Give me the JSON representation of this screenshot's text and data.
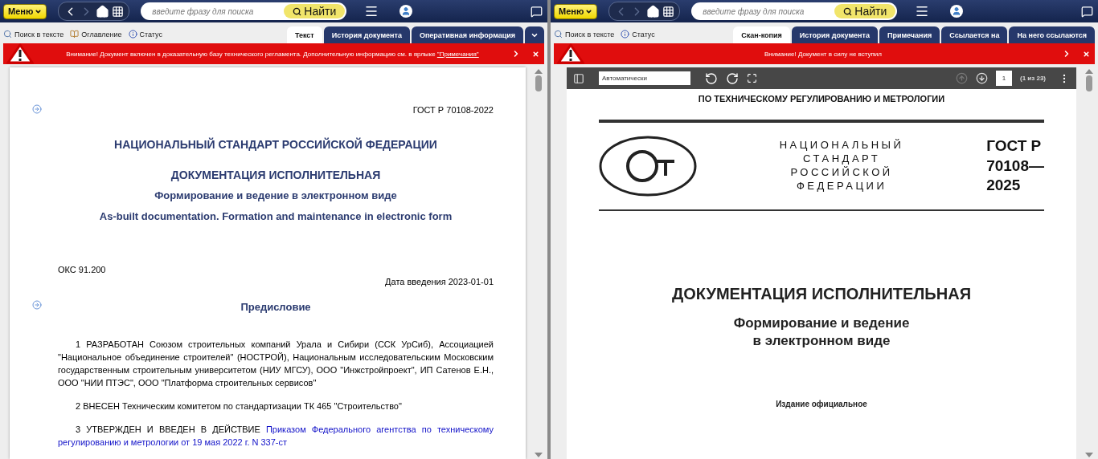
{
  "panels": [
    {
      "topbar": {
        "menu": "Меню",
        "nav": [
          {
            "disabled": false
          },
          {
            "disabled": true
          },
          {
            "disabled": false
          },
          {
            "disabled": false
          }
        ],
        "search": {
          "placeholder": "введите фразу для поиска",
          "button": "Найти"
        }
      },
      "tools": [
        {
          "kind": "search",
          "label": "Поиск в тексте"
        },
        {
          "kind": "contents",
          "label": "Оглавление"
        },
        {
          "kind": "status",
          "label": "Статус"
        }
      ],
      "tabs": [
        {
          "label": "Текст",
          "selected": true
        },
        {
          "label": "История документа",
          "selected": false
        },
        {
          "label": "Оперативная информация",
          "selected": false
        }
      ],
      "tabs_more": true,
      "alert": {
        "text": "Внимание! Документ включен в доказательную базу технического регламента. Дополнительную информацию см. в ярлыке ",
        "link": "\"Примечания\""
      },
      "content": {
        "kind": "text",
        "blocks": [
          {
            "kind": "right",
            "text": "ГОСТ Р 70108-2022",
            "marker": true
          },
          {
            "kind": "title",
            "text": "НАЦИОНАЛЬНЫЙ СТАНДАРТ РОССИЙСКОЙ ФЕДЕРАЦИИ",
            "marker": false
          },
          {
            "kind": "title",
            "text": "ДОКУМЕНТАЦИЯ ИСПОЛНИТЕЛЬНАЯ",
            "marker": false
          },
          {
            "kind": "subtitle",
            "text": "Формирование и ведение в электронном виде",
            "marker": false
          },
          {
            "kind": "subtitle",
            "text": "As-built documentation. Formation and maintenance in electronic form",
            "marker": false
          },
          {
            "kind": "left",
            "text": "ОКС 91.200",
            "marker": false
          },
          {
            "kind": "right",
            "text": "Дата введения 2023-01-01",
            "marker": false
          },
          {
            "kind": "heading",
            "text": "Предисловие",
            "marker": true
          },
          {
            "kind": "para",
            "number": "1",
            "text": " РАЗРАБОТАН Союзом строительных компаний Урала и Сибири (ССК УрСиб), Ассоциацией \"Национальное объединение строителей\" (НОСТРОЙ), Национальным исследовательским Московским государственным строительным университетом (НИУ МГСУ), ООО \"Инжстройпроект\", ИП Сатенов Е.Н., ООО \"НИИ ПТЭС\", ООО \"Платформа строительных сервисов\"",
            "marker": false
          },
          {
            "kind": "para",
            "number": "2",
            "text": " ВНЕСЕН Техническим комитетом по стандартизации ТК 465 \"Строительство\"",
            "marker": false
          },
          {
            "kind": "para",
            "number": "3",
            "text": " УТВЕРЖДЕН И ВВЕДЕН В ДЕЙСТВИЕ ",
            "link": "Приказом Федерального агентства по техническому регулированию и метрологии от 19 мая 2022 г. N 337-ст",
            "marker": false
          }
        ]
      }
    },
    {
      "topbar": {
        "menu": "Меню",
        "nav": [
          {
            "disabled": true
          },
          {
            "disabled": true
          },
          {
            "disabled": false
          },
          {
            "disabled": false
          }
        ],
        "search": {
          "placeholder": "введите фразу для поиска",
          "button": "Найти"
        }
      },
      "tools": [
        {
          "kind": "search",
          "label": "Поиск в тексте"
        },
        {
          "kind": "status",
          "label": "Статус"
        }
      ],
      "tabs": [
        {
          "label": "Скан-копия",
          "selected": true
        },
        {
          "label": "История документа",
          "selected": false
        },
        {
          "label": "Примечания",
          "selected": false
        },
        {
          "label": "Ссылается на",
          "selected": false
        },
        {
          "label": "На него ссылаются",
          "selected": false
        }
      ],
      "tabs_more": false,
      "alert": {
        "text": "Внимание! Документ в силу не вступил"
      },
      "content": {
        "kind": "scan",
        "viewer": {
          "zoom": "Автоматически",
          "page": "1",
          "page_count": "(1 из 23)",
          "prev_disabled": true,
          "next_disabled": false
        },
        "page": {
          "header": "ПО ТЕХНИЧЕСКОМУ РЕГУЛИРОВАНИЮ И МЕТРОЛОГИИ",
          "standard_lines": [
            "НАЦИОНАЛЬНЫЙ",
            "СТАНДАРТ",
            "РОССИЙСКОЙ",
            "ФЕДЕРАЦИИ"
          ],
          "code_lines": [
            "ГОСТ Р",
            "70108—",
            "2025"
          ],
          "title": "ДОКУМЕНТАЦИЯ ИСПОЛНИТЕЛЬНАЯ",
          "subtitle_lines": [
            "Формирование и ведение",
            "в электронном виде"
          ],
          "edition": "Издание официальное"
        }
      }
    }
  ]
}
